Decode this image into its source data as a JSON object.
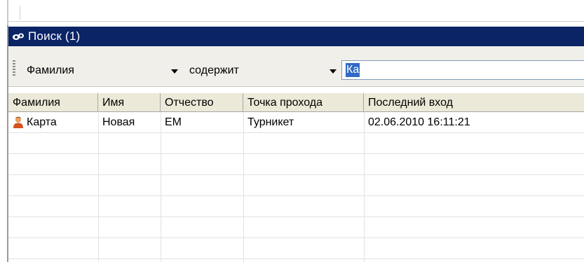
{
  "panel": {
    "title": "Поиск (1)",
    "icon": "eye-icon",
    "title_bg": "#0a2466"
  },
  "filter": {
    "field_value": "Фамилия",
    "operator_value": "содержит",
    "search_value": "Ка"
  },
  "grid": {
    "columns": [
      "Фамилия",
      "Имя",
      "Отчество",
      "Точка прохода",
      "Последний вход"
    ],
    "rows": [
      {
        "icon": "person-icon",
        "cells": [
          "Карта",
          "Новая",
          "ЕМ",
          "Турникет",
          "02.06.2010 16:11:21"
        ]
      }
    ]
  }
}
